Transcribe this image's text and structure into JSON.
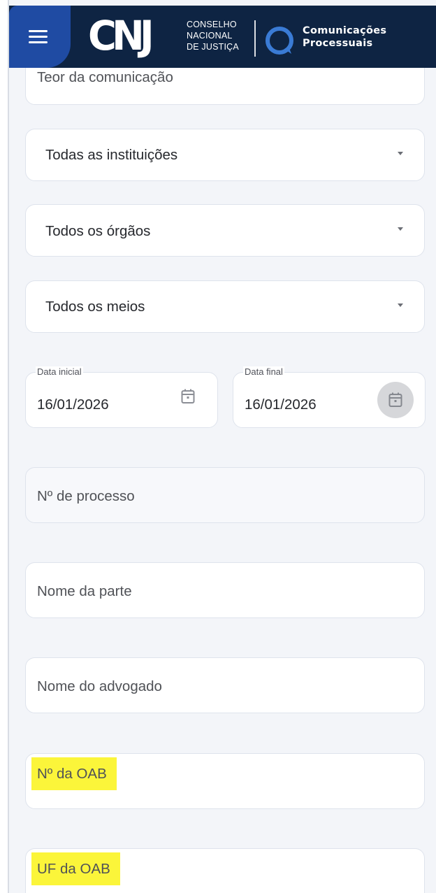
{
  "header": {
    "logo_text": "CNJ",
    "council_lines": [
      "CONSELHO",
      "NACIONAL",
      "DE JUSTIÇA"
    ],
    "app_title_line1": "Comunicações",
    "app_title_line2": "Processuais",
    "menu_icon": "hamburger-menu-icon",
    "app_icon": "speech-bubble-icon",
    "colors": {
      "header_bg": "#0e2443",
      "menu_bg": "#1f4ba3",
      "accent": "#3a7bd5",
      "highlight": "#fbf53a"
    }
  },
  "form": {
    "teor_placeholder": "Teor da comunicação",
    "instituicoes_selected": "Todas as instituições",
    "orgaos_selected": "Todos os órgãos",
    "meios_selected": "Todos os meios",
    "data_inicial_label": "Data inicial",
    "data_inicial_value": "16/01/2026",
    "data_final_label": "Data final",
    "data_final_value": "16/01/2026",
    "processo_placeholder": "Nº de processo",
    "parte_placeholder": "Nome da parte",
    "advogado_placeholder": "Nome do advogado",
    "oab_placeholder": "Nº da OAB",
    "uf_oab_placeholder": "UF da OAB"
  }
}
